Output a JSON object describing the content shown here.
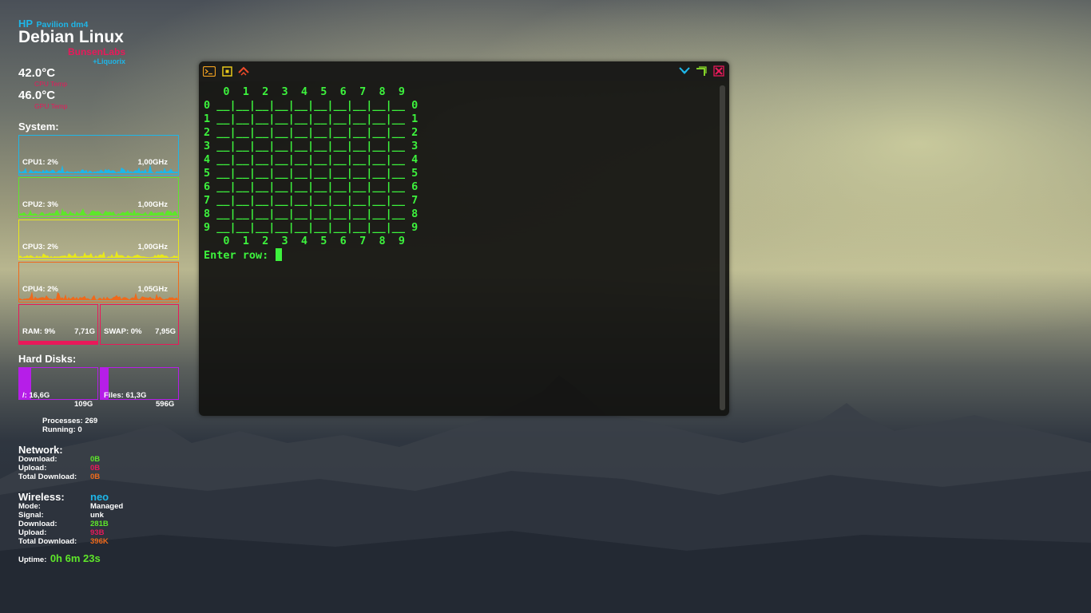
{
  "colors": {
    "cyan": "#1eb6e8",
    "green": "#5ee62a",
    "yellow": "#e8e81a",
    "orange": "#ef6a1c",
    "pink": "#e8195a",
    "purple": "#b61ee8",
    "terminal_green": "#3df23d"
  },
  "header": {
    "brand": "HP",
    "model": "Pavilion dm4",
    "os": "Debian Linux",
    "distro": "BunsenLabs",
    "variant": "+Liquorix"
  },
  "temps": [
    {
      "value": "42.0°C",
      "label": "CPU Temp"
    },
    {
      "value": "46.0°C",
      "label": "GPU Temp"
    }
  ],
  "system": {
    "heading": "System:",
    "cpus": [
      {
        "label": "CPU1: 2%",
        "freq": "1,00GHz",
        "usage": 0.02
      },
      {
        "label": "CPU2: 3%",
        "freq": "1,00GHz",
        "usage": 0.03
      },
      {
        "label": "CPU3: 2%",
        "freq": "1,00GHz",
        "usage": 0.02
      },
      {
        "label": "CPU4: 2%",
        "freq": "1,05GHz",
        "usage": 0.02
      }
    ],
    "ram": {
      "label": "RAM: 9%",
      "total": "7,71G",
      "usage": 0.09
    },
    "swap": {
      "label": "SWAP: 0%",
      "total": "7,95G",
      "usage": 0.0
    }
  },
  "disks": {
    "heading": "Hard Disks:",
    "items": [
      {
        "label": "/: 16,6G",
        "total": "109G",
        "usage": 0.15
      },
      {
        "label": "Files: 61,3G",
        "total": "596G",
        "usage": 0.1
      }
    ]
  },
  "processes": {
    "processes": "Processes: 269",
    "running": "Running: 0"
  },
  "network": {
    "heading": "Network:",
    "download_label": "Download:",
    "download": "0B",
    "upload_label": "Upload:",
    "upload": "0B",
    "total_label": "Total Download:",
    "total": "0B"
  },
  "wireless": {
    "heading": "Wireless:",
    "ssid": "neo",
    "mode_label": "Mode:",
    "mode": "Managed",
    "signal_label": "Signal:",
    "signal": "unk",
    "download_label": "Download:",
    "download": "281B",
    "upload_label": "Upload:",
    "upload": "93B",
    "total_label": "Total Download:",
    "total": "396K"
  },
  "uptime": {
    "label": "Uptime:",
    "value": "0h 6m 23s"
  },
  "terminal": {
    "icons": [
      "terminal-icon",
      "maximize-icon",
      "chevron-up-icon",
      "chevron-down-icon",
      "restore-icon",
      "close-icon"
    ],
    "lines": [
      "   0  1  2  3  4  5  6  7  8  9",
      "0 __|__|__|__|__|__|__|__|__|__ 0",
      "1 __|__|__|__|__|__|__|__|__|__ 1",
      "2 __|__|__|__|__|__|__|__|__|__ 2",
      "3 __|__|__|__|__|__|__|__|__|__ 3",
      "4 __|__|__|__|__|__|__|__|__|__ 4",
      "5 __|__|__|__|__|__|__|__|__|__ 5",
      "6 __|__|__|__|__|__|__|__|__|__ 6",
      "7 __|__|__|__|__|__|__|__|__|__ 7",
      "8 __|__|__|__|__|__|__|__|__|__ 8",
      "9 __|__|__|__|__|__|__|__|__|__ 9",
      "   0  1  2  3  4  5  6  7  8  9"
    ],
    "prompt": "Enter row: "
  }
}
